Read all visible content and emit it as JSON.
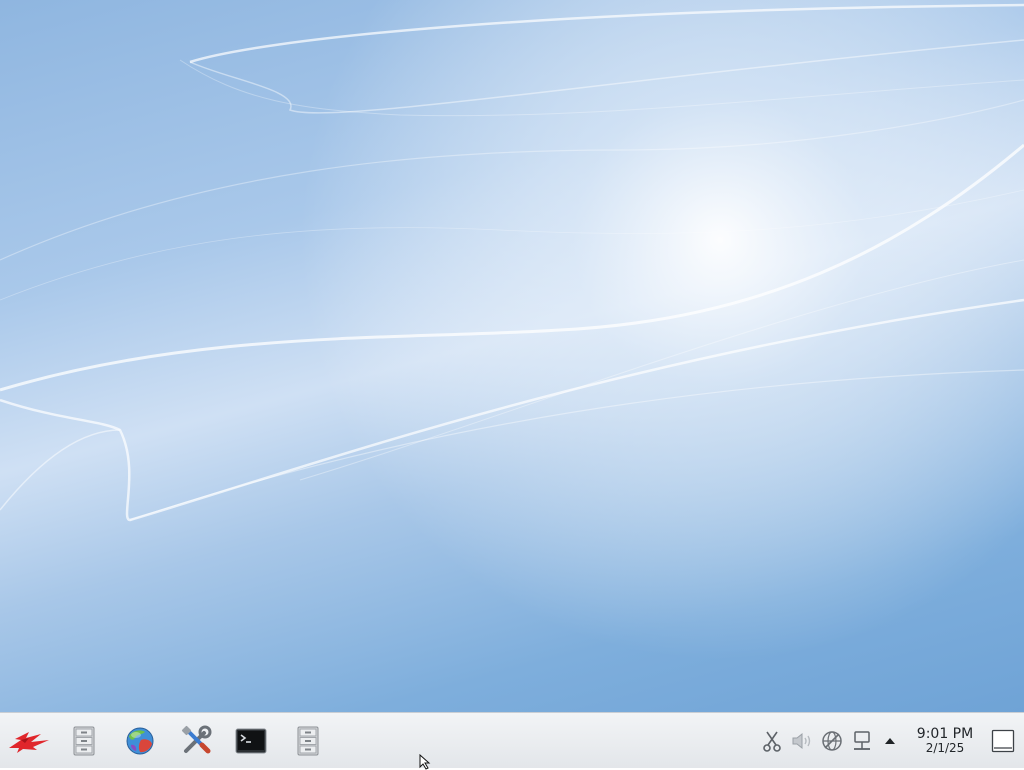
{
  "desktop": {
    "wallpaper": "blue-silk-waves"
  },
  "taskbar": {
    "launchers": [
      {
        "name": "application-menu",
        "icon": "red-bird-logo-icon"
      },
      {
        "name": "file-manager",
        "icon": "file-cabinet-icon"
      },
      {
        "name": "web-browser",
        "icon": "globe-icon"
      },
      {
        "name": "system-settings",
        "icon": "tools-icon"
      },
      {
        "name": "terminal",
        "icon": "terminal-icon"
      },
      {
        "name": "file-manager-2",
        "icon": "file-cabinet-icon"
      }
    ],
    "tray": [
      {
        "name": "clipboard",
        "icon": "scissors-icon"
      },
      {
        "name": "volume",
        "icon": "speaker-icon"
      },
      {
        "name": "network-status",
        "icon": "globe-disconnected-icon"
      },
      {
        "name": "network",
        "icon": "computer-network-icon"
      },
      {
        "name": "show-hidden",
        "icon": "arrow-up-icon"
      }
    ],
    "clock": {
      "time": "9:01 PM",
      "date": "2/1/25"
    },
    "show_desktop": {
      "icon": "show-desktop-icon"
    }
  },
  "colors": {
    "taskbar_bg": "#eceef1",
    "accent_red": "#e0262b",
    "wallpaper_blue": "#8fb6e0"
  }
}
